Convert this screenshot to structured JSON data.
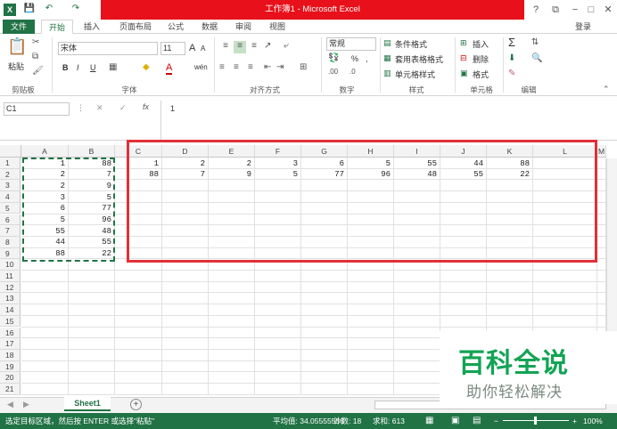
{
  "window": {
    "title": "工作簿1 - Microsoft Excel",
    "min_label": "−",
    "max_label": "□",
    "close_label": "✕",
    "help_label": "?",
    "restore_label": "⧉"
  },
  "quick_access": {
    "save": "💾",
    "undo": "↶",
    "redo": "↷"
  },
  "tabs": {
    "file": "文件",
    "home": "开始",
    "insert": "插入",
    "layout": "页面布局",
    "formulas": "公式",
    "data": "数据",
    "review": "审阅",
    "view": "视图",
    "login": "登录"
  },
  "ribbon": {
    "clipboard": {
      "paste": "粘贴",
      "label": "剪贴板"
    },
    "font": {
      "name": "宋体",
      "size": "11",
      "bold": "B",
      "italic": "I",
      "underline": "U",
      "grow": "A",
      "shrink": "A",
      "label": "字体",
      "color_a": "A",
      "phonetic": "wén"
    },
    "align": {
      "label": "对齐方式"
    },
    "number": {
      "format": "常规",
      "percent": "%",
      "comma": ",",
      "label": "数字"
    },
    "styles": {
      "cond": "条件格式",
      "table": "套用表格格式",
      "cell": "单元格样式",
      "label": "样式"
    },
    "cells": {
      "insert": "插入",
      "delete": "删除",
      "format": "格式",
      "label": "单元格"
    },
    "editing": {
      "sum": "Σ",
      "label": "编辑"
    }
  },
  "formula_bar": {
    "name_box": "C1",
    "cancel": "✕",
    "enter": "✓",
    "fx": "fx",
    "value": "1"
  },
  "columns": [
    "A",
    "B",
    "C",
    "D",
    "E",
    "F",
    "G",
    "H",
    "I",
    "J",
    "K",
    "L",
    "M"
  ],
  "rows": [
    "1",
    "2",
    "3",
    "4",
    "5",
    "6",
    "7",
    "8",
    "9",
    "10",
    "11",
    "12",
    "13",
    "14",
    "15",
    "16",
    "17",
    "18",
    "19",
    "20",
    "21"
  ],
  "source": {
    "A": [
      "1",
      "2",
      "2",
      "3",
      "6",
      "5",
      "55",
      "44",
      "88"
    ],
    "B": [
      "88",
      "7",
      "9",
      "5",
      "77",
      "96",
      "48",
      "55",
      "22"
    ]
  },
  "transposed": {
    "row1": [
      "1",
      "2",
      "2",
      "3",
      "6",
      "5",
      "55",
      "44",
      "88"
    ],
    "row2": [
      "88",
      "7",
      "9",
      "5",
      "77",
      "96",
      "48",
      "55",
      "22"
    ]
  },
  "sheets": {
    "active": "Sheet1",
    "add": "+"
  },
  "status": {
    "message": "选定目标区域，然后按 ENTER 或选择\"粘贴\"",
    "average": "平均值: 34.05555556",
    "count": "计数: 18",
    "sum": "求和: 613",
    "zoom": "100%",
    "minus": "−",
    "plus": "+"
  },
  "watermark": {
    "title": "百科全说",
    "subtitle": "助你轻松解决"
  },
  "colors": {
    "excel_green": "#217346",
    "highlight_red": "#e23037",
    "title_red": "#e8101a",
    "watermark_green": "#12a454"
  }
}
